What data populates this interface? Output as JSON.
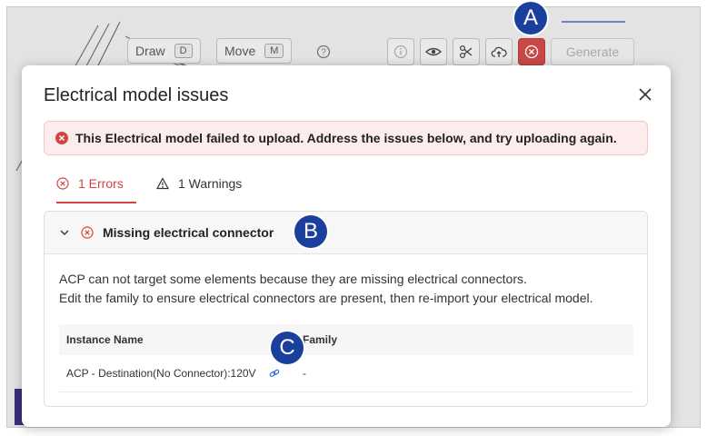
{
  "toolbar": {
    "draw_label": "Draw",
    "draw_key": "D",
    "move_label": "Move",
    "move_key": "M",
    "generate_label": "Generate"
  },
  "modal": {
    "title": "Electrical model issues",
    "banner_text": "This Electrical model failed to upload. Address the issues below, and try uploading again.",
    "tabs": [
      {
        "label": "1 Errors",
        "active": true
      },
      {
        "label": "1 Warnings",
        "active": false
      }
    ],
    "issue": {
      "title": "Missing electrical connector",
      "description_lines": [
        "ACP can not target some elements because they are missing electrical connectors.",
        "Edit the family to ensure electrical connectors are present, then re-import your electrical model."
      ],
      "columns": [
        "Instance Name",
        "Family"
      ],
      "rows": [
        {
          "instance_name": "ACP - Destination(No Connector):120V",
          "family": "-"
        }
      ]
    }
  },
  "callouts": [
    "A",
    "B",
    "C"
  ],
  "colors": {
    "error_red": "#d24545",
    "callout_blue": "#1b3f9c",
    "banner_bg": "#fdecec"
  },
  "icons": [
    "help-icon",
    "info-icon",
    "eye-icon",
    "scissors-icon",
    "cloud-upload-icon",
    "error-circle-icon",
    "close-icon",
    "warning-triangle-icon",
    "chevron-down-icon",
    "link-icon"
  ]
}
